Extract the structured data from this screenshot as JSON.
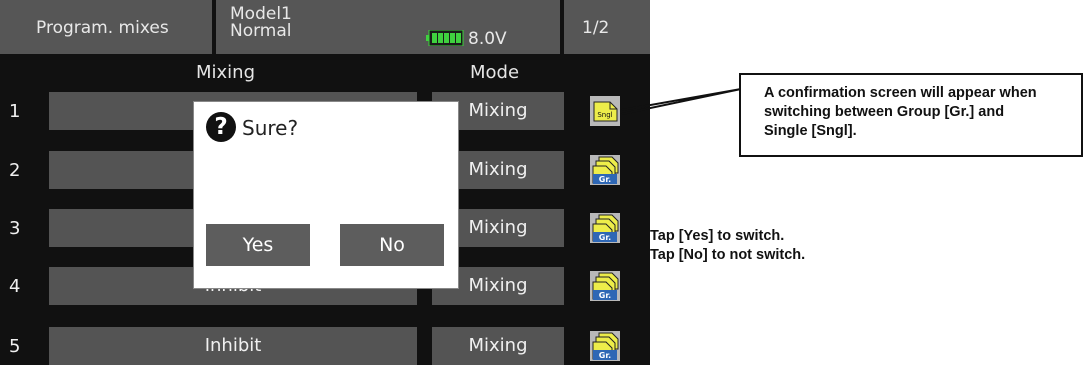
{
  "header": {
    "screen_title": "Program. mixes",
    "model_name": "Model1",
    "condition": "Normal",
    "battery_voltage": "8.0V",
    "page_indicator": "1/2"
  },
  "columns": {
    "mixing": "Mixing",
    "mode": "Mode"
  },
  "rows": [
    {
      "number": "1",
      "mix": "",
      "mode": "Mixing",
      "type_icon": "Sngl"
    },
    {
      "number": "2",
      "mix": "",
      "mode": "Mixing",
      "type_icon": "Gr."
    },
    {
      "number": "3",
      "mix": "",
      "mode": "Mixing",
      "type_icon": "Gr."
    },
    {
      "number": "4",
      "mix": "Inhibit",
      "mode": "Mixing",
      "type_icon": "Gr."
    },
    {
      "number": "5",
      "mix": "Inhibit",
      "mode": "Mixing",
      "type_icon": "Gr."
    }
  ],
  "dialog": {
    "title": "Sure?",
    "yes_label": "Yes",
    "no_label": "No",
    "icon": "question-icon"
  },
  "annotations": {
    "callout_line1": "A confirmation screen will appear when",
    "callout_line2": "switching between Group [Gr.] and",
    "callout_line3": "Single [Sngl].",
    "note_line1": "Tap [Yes] to switch.",
    "note_line2": "Tap [No] to not switch."
  },
  "colors": {
    "screen_bg": "#111111",
    "button_gray": "#545454",
    "icon_yellow": "#eded4a",
    "battery_green": "#3fd13f"
  }
}
